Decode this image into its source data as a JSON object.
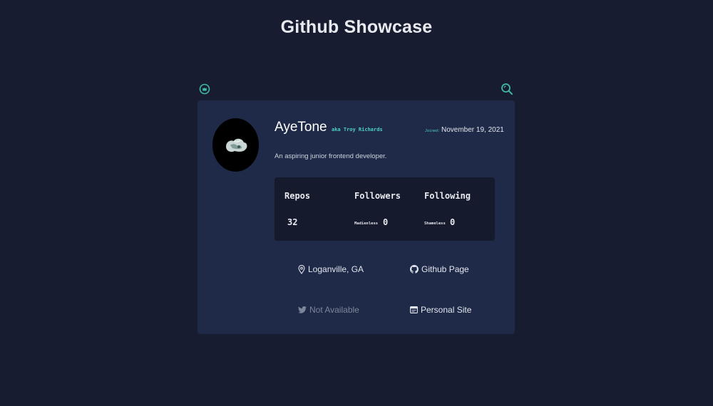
{
  "header": {
    "title": "Github Showcase"
  },
  "profile": {
    "username": "AyeTone",
    "aka": "aka Troy Richards",
    "joined_label": "Joined:",
    "joined_date": "November 19, 2021",
    "bio": "An aspiring junior frontend developer."
  },
  "stats": {
    "repos": {
      "label": "Repos",
      "value": "32"
    },
    "followers": {
      "label": "Followers",
      "prefix": "Madienless",
      "value": "0"
    },
    "following": {
      "label": "Following",
      "prefix": "Shameless",
      "value": "0"
    }
  },
  "links": {
    "location": {
      "text": "Loganville, GA",
      "icon": "map-pin-icon"
    },
    "github": {
      "text": "Github Page",
      "icon": "github-icon"
    },
    "twitter": {
      "text": "Not Available",
      "icon": "twitter-icon"
    },
    "website": {
      "text": "Personal Site",
      "icon": "browser-icon"
    }
  },
  "colors": {
    "background": "#181c30",
    "card": "#1f2a48",
    "stats_panel": "#151a2c",
    "accent": "#4dd0c8"
  }
}
